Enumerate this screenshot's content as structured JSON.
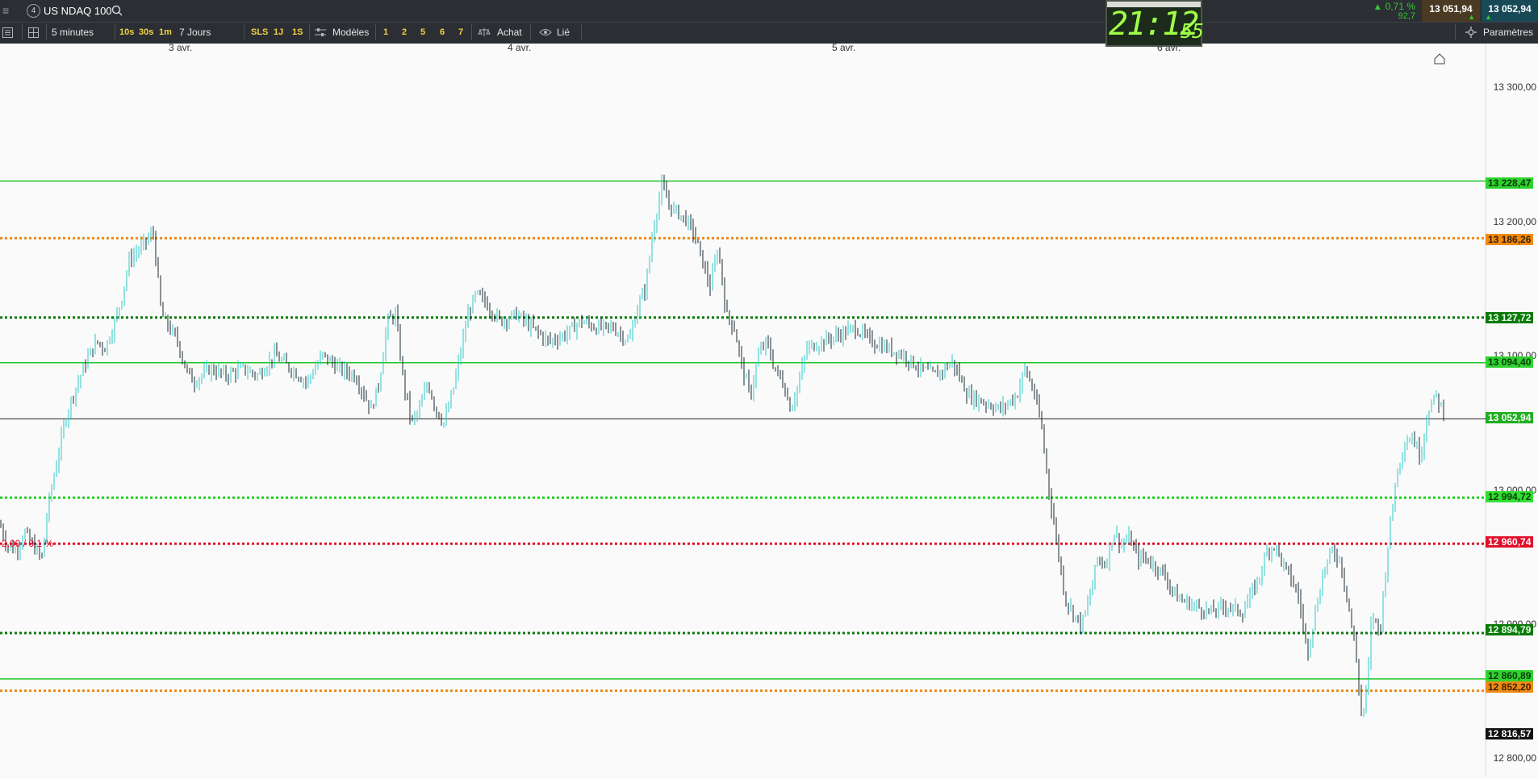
{
  "header": {
    "menu_icon": "hamburger-icon",
    "instrument_number": "4",
    "instrument_name": "US NDAQ 100",
    "search_icon": "search-icon"
  },
  "quote": {
    "change_pct": "▲ 0,71 %",
    "change_pts": "92,7",
    "bid": "13 051,94",
    "ask": "13 052,94"
  },
  "clock": {
    "hm": "21:12",
    "sec": "55"
  },
  "toolbar": {
    "timeframe": "5 minutes",
    "quick_intervals": [
      "10s",
      "30s",
      "1m"
    ],
    "period": "7 Jours",
    "ranges": [
      "SLS",
      "1J",
      "1S"
    ],
    "templates_label": "Modèles",
    "layouts": [
      "1",
      "2",
      "5",
      "6",
      "7"
    ],
    "buy_label": "Achat",
    "linked_label": "Lié",
    "settings_label": "Paramètres"
  },
  "dates": [
    "3 avr.",
    "4 avr.",
    "5 avr.",
    "6 avr."
  ],
  "yaxis_labels": [
    "13 300,00",
    "13 200,00",
    "13 100,00",
    "13 000,00",
    "12 900,00",
    "12 800,00"
  ],
  "levels": [
    {
      "value": "13 228,47",
      "color": "#22c522",
      "style": "solid"
    },
    {
      "value": "13 186,26",
      "color": "#f08a12",
      "style": "dotted"
    },
    {
      "value": "13 127,72",
      "color": "#0b7a0b",
      "style": "dotted"
    },
    {
      "value": "13 094,40",
      "color": "#22c522",
      "style": "solid"
    },
    {
      "value": "13 052,94",
      "color": "#22b422",
      "style": "current"
    },
    {
      "value": "12 994,72",
      "color": "#19d019",
      "style": "dotted"
    },
    {
      "value": "12 960,74",
      "color": "#e0102a",
      "style": "dotted"
    },
    {
      "value": "12 894,79",
      "color": "#0b7a0b",
      "style": "dotted"
    },
    {
      "value": "12 860,89",
      "color": "#22c522",
      "style": "solid"
    },
    {
      "value": "12 852,20",
      "color": "#f08a12",
      "style": "dotted"
    },
    {
      "value": "12 816,57",
      "color": "#111111",
      "style": "low"
    }
  ],
  "annotation": "2,00 / 0,1 %",
  "chart_data": {
    "type": "candlestick",
    "instrument": "US NDAQ 100",
    "interval": "5 minutes",
    "ylim": [
      12790,
      13330
    ],
    "x_ticks": [
      "3 avr.",
      "4 avr.",
      "5 avr.",
      "6 avr."
    ],
    "path": [
      [
        0,
        12975
      ],
      [
        8,
        12960
      ],
      [
        20,
        12955
      ],
      [
        30,
        12970
      ],
      [
        40,
        12960
      ],
      [
        52,
        12950
      ],
      [
        60,
        12990
      ],
      [
        70,
        13020
      ],
      [
        80,
        13050
      ],
      [
        90,
        13070
      ],
      [
        100,
        13085
      ],
      [
        110,
        13100
      ],
      [
        120,
        13110
      ],
      [
        130,
        13105
      ],
      [
        140,
        13120
      ],
      [
        150,
        13140
      ],
      [
        160,
        13170
      ],
      [
        175,
        13180
      ],
      [
        190,
        13190
      ],
      [
        200,
        13130
      ],
      [
        210,
        13120
      ],
      [
        220,
        13110
      ],
      [
        230,
        13090
      ],
      [
        240,
        13080
      ],
      [
        260,
        13090
      ],
      [
        280,
        13085
      ],
      [
        300,
        13090
      ],
      [
        320,
        13085
      ],
      [
        340,
        13100
      ],
      [
        360,
        13090
      ],
      [
        380,
        13080
      ],
      [
        400,
        13100
      ],
      [
        420,
        13090
      ],
      [
        440,
        13085
      ],
      [
        460,
        13060
      ],
      [
        470,
        13080
      ],
      [
        480,
        13125
      ],
      [
        490,
        13130
      ],
      [
        500,
        13080
      ],
      [
        510,
        13050
      ],
      [
        520,
        13060
      ],
      [
        530,
        13080
      ],
      [
        540,
        13060
      ],
      [
        550,
        13050
      ],
      [
        560,
        13070
      ],
      [
        570,
        13100
      ],
      [
        580,
        13130
      ],
      [
        590,
        13145
      ],
      [
        600,
        13140
      ],
      [
        620,
        13125
      ],
      [
        640,
        13130
      ],
      [
        660,
        13120
      ],
      [
        680,
        13110
      ],
      [
        700,
        13115
      ],
      [
        720,
        13125
      ],
      [
        740,
        13120
      ],
      [
        760,
        13120
      ],
      [
        780,
        13110
      ],
      [
        790,
        13135
      ],
      [
        800,
        13150
      ],
      [
        810,
        13195
      ],
      [
        820,
        13225
      ],
      [
        830,
        13210
      ],
      [
        840,
        13205
      ],
      [
        850,
        13200
      ],
      [
        860,
        13190
      ],
      [
        870,
        13170
      ],
      [
        880,
        13150
      ],
      [
        890,
        13180
      ],
      [
        900,
        13130
      ],
      [
        910,
        13120
      ],
      [
        920,
        13090
      ],
      [
        930,
        13070
      ],
      [
        940,
        13100
      ],
      [
        950,
        13110
      ],
      [
        960,
        13090
      ],
      [
        970,
        13080
      ],
      [
        980,
        13060
      ],
      [
        990,
        13080
      ],
      [
        1000,
        13105
      ],
      [
        1020,
        13110
      ],
      [
        1040,
        13115
      ],
      [
        1060,
        13120
      ],
      [
        1080,
        13110
      ],
      [
        1100,
        13105
      ],
      [
        1120,
        13100
      ],
      [
        1140,
        13090
      ],
      [
        1160,
        13085
      ],
      [
        1180,
        13095
      ],
      [
        1200,
        13070
      ],
      [
        1220,
        13065
      ],
      [
        1240,
        13060
      ],
      [
        1260,
        13070
      ],
      [
        1270,
        13090
      ],
      [
        1280,
        13075
      ],
      [
        1290,
        13050
      ],
      [
        1300,
        13000
      ],
      [
        1310,
        12960
      ],
      [
        1320,
        12920
      ],
      [
        1330,
        12910
      ],
      [
        1340,
        12900
      ],
      [
        1350,
        12920
      ],
      [
        1360,
        12950
      ],
      [
        1370,
        12945
      ],
      [
        1380,
        12970
      ],
      [
        1390,
        12960
      ],
      [
        1400,
        12965
      ],
      [
        1410,
        12950
      ],
      [
        1420,
        12950
      ],
      [
        1440,
        12940
      ],
      [
        1460,
        12920
      ],
      [
        1480,
        12915
      ],
      [
        1500,
        12910
      ],
      [
        1520,
        12915
      ],
      [
        1540,
        12910
      ],
      [
        1560,
        12935
      ],
      [
        1570,
        12955
      ],
      [
        1580,
        12960
      ],
      [
        1590,
        12945
      ],
      [
        1600,
        12935
      ],
      [
        1610,
        12920
      ],
      [
        1620,
        12880
      ],
      [
        1630,
        12910
      ],
      [
        1640,
        12940
      ],
      [
        1650,
        12955
      ],
      [
        1660,
        12950
      ],
      [
        1670,
        12920
      ],
      [
        1680,
        12880
      ],
      [
        1688,
        12830
      ],
      [
        1695,
        12860
      ],
      [
        1700,
        12910
      ],
      [
        1710,
        12895
      ],
      [
        1720,
        12960
      ],
      [
        1730,
        13010
      ],
      [
        1740,
        13035
      ],
      [
        1750,
        13040
      ],
      [
        1760,
        13025
      ],
      [
        1770,
        13060
      ],
      [
        1780,
        13070
      ],
      [
        1785,
        13062
      ],
      [
        1790,
        13058
      ]
    ]
  }
}
